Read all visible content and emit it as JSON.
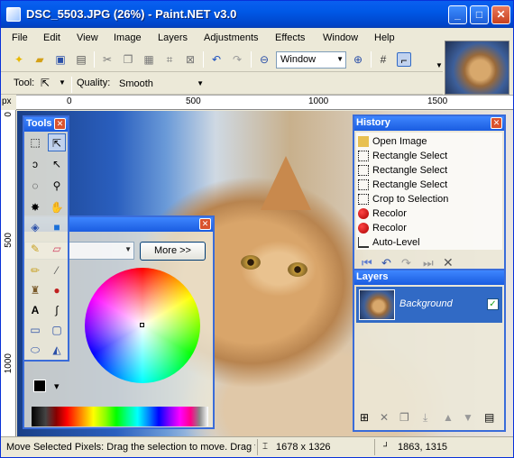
{
  "window": {
    "title": "DSC_5503.JPG (26%) - Paint.NET v3.0",
    "min": "_",
    "max": "□",
    "close": "✕"
  },
  "menu": [
    "File",
    "Edit",
    "View",
    "Image",
    "Layers",
    "Adjustments",
    "Effects",
    "Window",
    "Help"
  ],
  "toolbar": {
    "zoom_value": "Window"
  },
  "toolbar2": {
    "tool_label": "Tool:",
    "quality_label": "Quality:",
    "quality_value": "Smooth"
  },
  "ruler": {
    "unit": "px",
    "h_ticks": [
      "0",
      "500",
      "1000",
      "1500"
    ],
    "v_ticks": [
      "0",
      "500",
      "1000"
    ]
  },
  "tools_panel": {
    "title": "Tools"
  },
  "colors_panel": {
    "more_label": "More >>"
  },
  "history_panel": {
    "title": "History",
    "items": [
      "Open Image",
      "Rectangle Select",
      "Rectangle Select",
      "Rectangle Select",
      "Crop to Selection",
      "Recolor",
      "Recolor",
      "Auto-Level"
    ]
  },
  "layers_panel": {
    "title": "Layers",
    "layer_name": "Background",
    "visible": true
  },
  "status": {
    "message": "Move Selected Pixels: Drag the selection to move. Drag t",
    "image_size": "1678 x 1326",
    "cursor": "1863, 1315"
  }
}
